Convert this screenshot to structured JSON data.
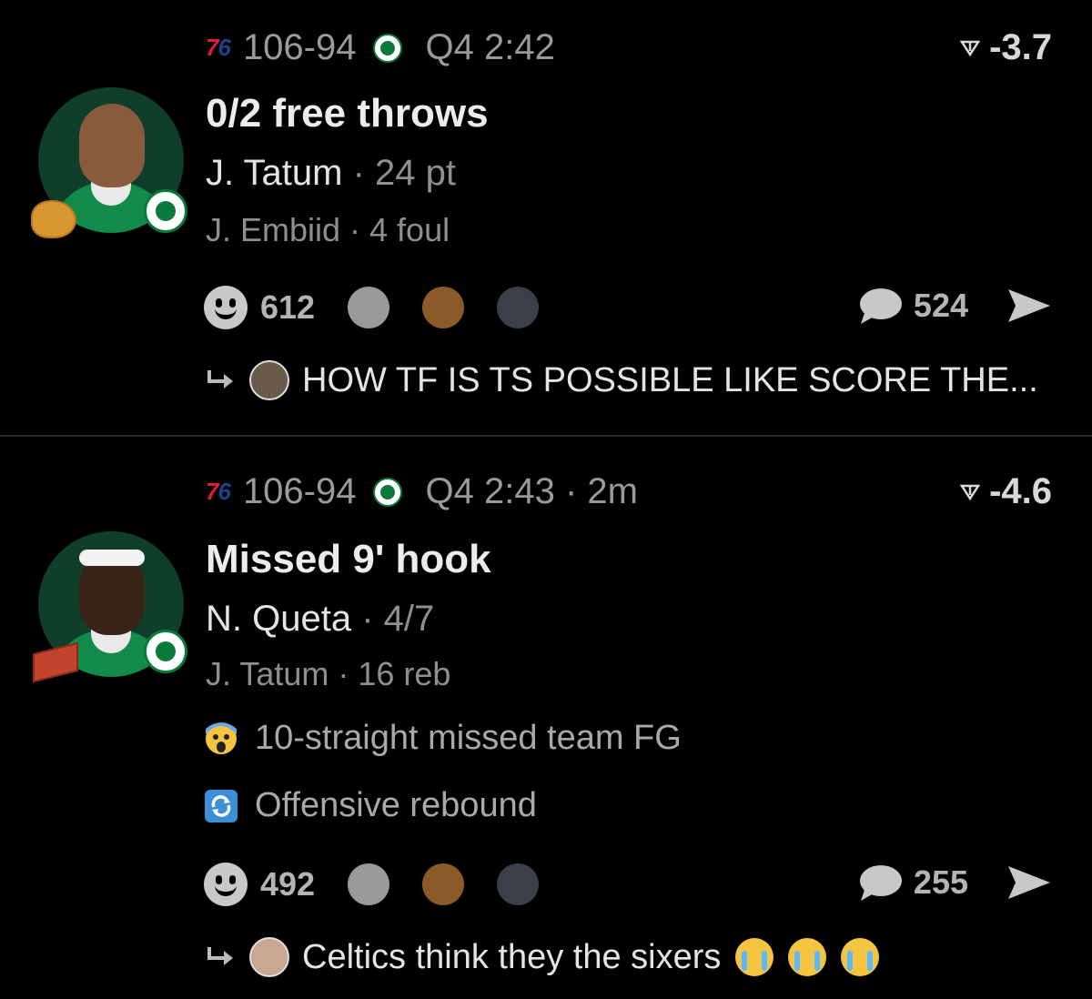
{
  "posts": [
    {
      "score": "106-94",
      "clock": "Q4 2:42",
      "win_prob": "-3.7",
      "headline": "0/2 free throws",
      "player": "J. Tatum",
      "player_stat": "· 24 pt",
      "secondary": "J. Embiid · 4 foul",
      "tags": [],
      "reactions": "612",
      "comments": "524",
      "reply_text": "HOW TF IS TS POSSIBLE LIKE SCORE THE...",
      "avatar_emoji": "chicken-nugget-icon"
    },
    {
      "score": "106-94",
      "clock": "Q4 2:43 · 2m",
      "win_prob": "-4.6",
      "headline": "Missed 9' hook",
      "player": "N. Queta",
      "player_stat": "· 4/7",
      "secondary": "J. Tatum · 16 reb",
      "tags": [
        {
          "icon": "scream-emoji-icon",
          "text": "10-straight missed team FG"
        },
        {
          "icon": "refresh-icon",
          "text": "Offensive rebound"
        }
      ],
      "reactions": "492",
      "comments": "255",
      "reply_text": "Celtics think they the sixers",
      "avatar_emoji": "brick-icon"
    }
  ],
  "logos": {
    "sixers_text": "76"
  },
  "colors": {
    "background": "#000000",
    "celtics_green": "#0a7a3a",
    "sixers_blue": "#1d428a",
    "sixers_red": "#e01e38"
  }
}
